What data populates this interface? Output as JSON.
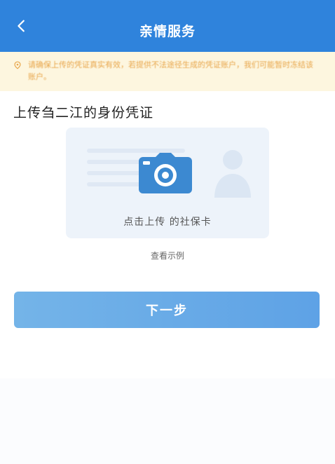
{
  "header": {
    "title": "亲情服务",
    "back_icon": "chevron-left-icon",
    "background": "#2f83dc"
  },
  "notice": {
    "icon": "warning-icon",
    "text": "请确保上传的凭证真实有效，若提供不法途径生成的凭证账户，我们可能暂时冻结该账户。",
    "text_color": "#e8a64b",
    "background": "#fdf6df"
  },
  "main": {
    "section_title": "上传刍二江的身份凭证",
    "upload_card": {
      "caption": "点击上传      的社保卡",
      "camera_icon": "camera-icon",
      "portrait_icon": "person-silhouette-icon",
      "icon_color": "#3c89d1"
    },
    "example_link": "查看示例",
    "next_button": "下一步"
  }
}
